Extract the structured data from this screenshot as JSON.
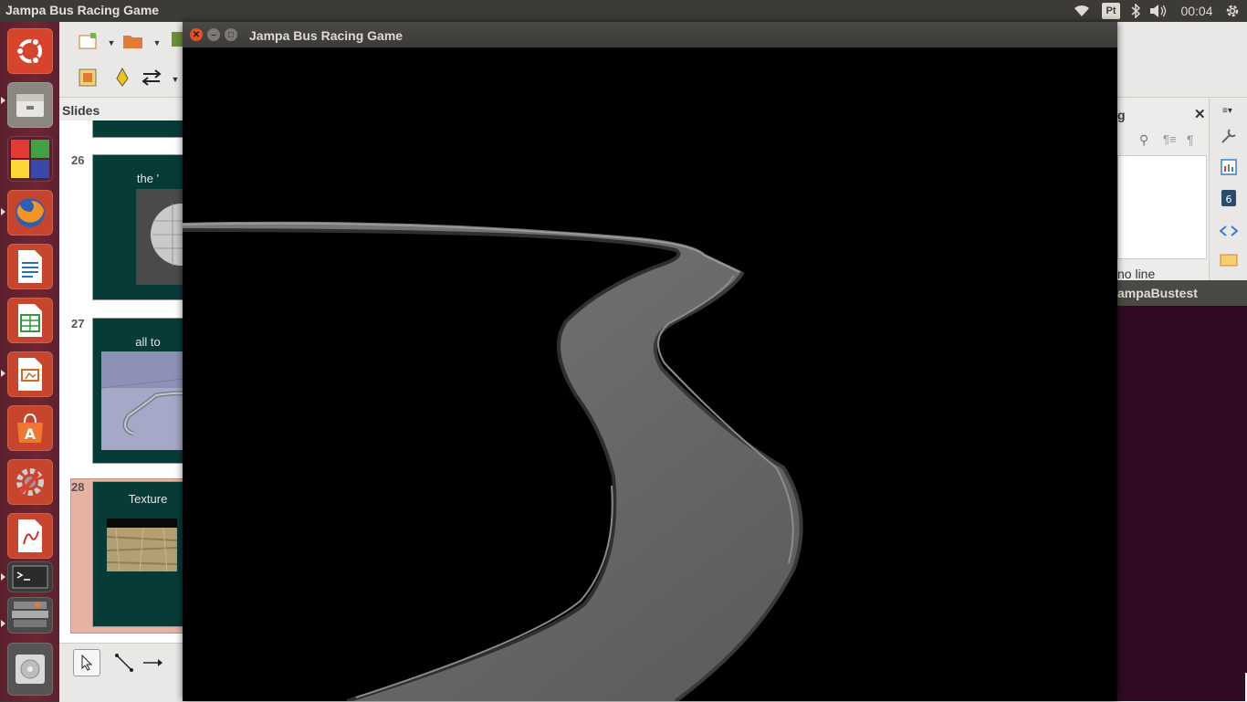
{
  "top_panel": {
    "title": "Jampa Bus Racing Game",
    "keyboard_layout": "Pt",
    "clock": "00:04",
    "icons": [
      "wifi-icon",
      "keyboard-layout-indicator",
      "bluetooth-icon",
      "volume-icon",
      "system-gear-icon"
    ]
  },
  "launcher": {
    "items": [
      {
        "name": "ubuntu-dash",
        "color": "#c7452d"
      },
      {
        "name": "files",
        "color": "#c7452d"
      },
      {
        "name": "workspaces",
        "color": "#c7452d"
      },
      {
        "name": "firefox",
        "color": "#c7452d"
      },
      {
        "name": "libreoffice-writer",
        "color": "#c7452d"
      },
      {
        "name": "libreoffice-calc",
        "color": "#c7452d"
      },
      {
        "name": "libreoffice-impress",
        "color": "#c7452d"
      },
      {
        "name": "ubuntu-software-center",
        "color": "#c7452d"
      },
      {
        "name": "system-settings",
        "color": "#c7452d"
      },
      {
        "name": "document-viewer",
        "color": "#c7452d"
      },
      {
        "name": "terminal",
        "color": "#c7452d"
      },
      {
        "name": "stacked-apps",
        "color": "#c7452d"
      },
      {
        "name": "dvd-drive",
        "color": "#c7452d"
      }
    ]
  },
  "impress": {
    "slides_label": "Slides",
    "slides": [
      {
        "number": "26",
        "text": "the '"
      },
      {
        "number": "27",
        "text": "all to"
      },
      {
        "number": "28",
        "text": "Texture"
      }
    ],
    "sidebar_partial_title": "g",
    "sidebar_partial_text": "no line",
    "selected_slide_color": "#e6b3a3",
    "slide_bg_color": "#063b38"
  },
  "terminal": {
    "title_partial": "ampaBustest"
  },
  "game_window": {
    "title": "Jampa Bus Racing Game",
    "close_color": "#e0532a",
    "road_color": "#6a6a6a"
  }
}
